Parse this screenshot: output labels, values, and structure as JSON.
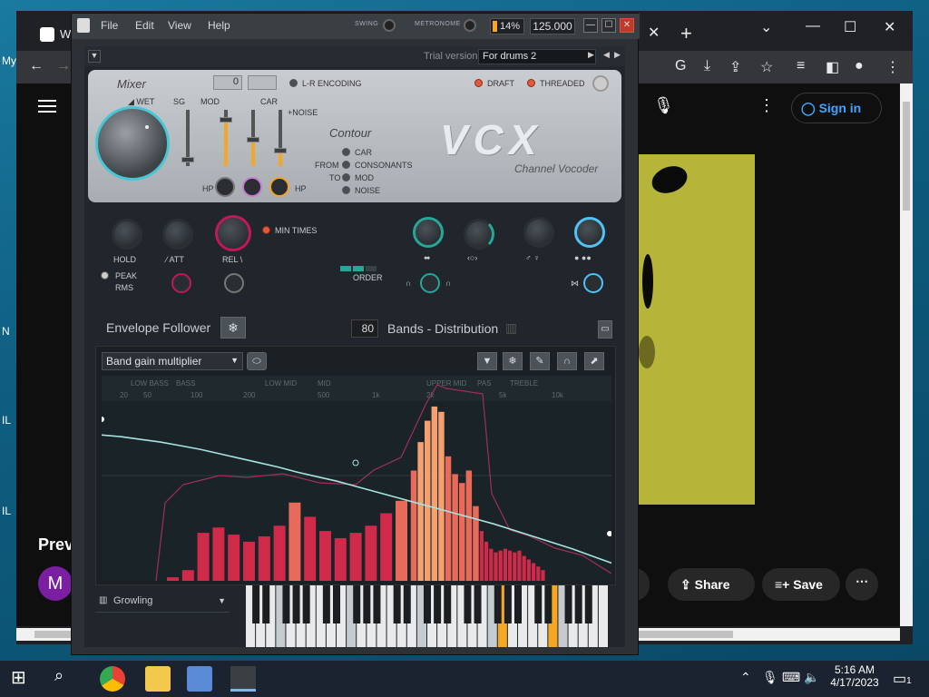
{
  "desktop": {
    "labels": [
      "My",
      "N",
      "IL",
      "IL"
    ]
  },
  "chrome": {
    "tab_title": "WE",
    "new_tab": "+",
    "tab_close": "✕",
    "signin": "Sign in",
    "preview_title": "Prev",
    "avatar_letter": "M",
    "share": "Share",
    "save": "Save"
  },
  "fl": {
    "menu": [
      "File",
      "Edit",
      "View",
      "Help"
    ],
    "swing_label": "SWING",
    "metronome_label": "METRONOME",
    "cpu": "14%",
    "tempo": "125.000",
    "trial": "Trial version",
    "preset": "For drums 2",
    "vcx": {
      "mixer": "Mixer",
      "wet": "WET",
      "sg": "SG",
      "mod": "MOD",
      "car": "CAR",
      "noise": "+NOISE",
      "hp1": "HP",
      "hp2": "HP",
      "num1": "0",
      "num2": "",
      "lr_encoding": "L-R ENCODING",
      "draft": "DRAFT",
      "threaded": "THREADED",
      "contour": "Contour",
      "from": "FROM",
      "to": "TO",
      "contour_options": [
        "CAR",
        "CONSONANTS",
        "MOD",
        "NOISE"
      ],
      "logo": "VCX",
      "subtitle": "Channel Vocoder"
    },
    "envelope": {
      "hold": "HOLD",
      "att": "ATT",
      "rel": "REL",
      "min_times": "MIN TIMES",
      "peak": "PEAK",
      "rms": "RMS",
      "order": "ORDER",
      "title": "Envelope Follower"
    },
    "bands": {
      "count": "80",
      "label": "Bands - Distribution"
    },
    "graph": {
      "mode": "Band gain multiplier",
      "region_labels": [
        "LOW BASS",
        "BASS",
        "LOW MID",
        "MID",
        "UPPER MID",
        "PAS",
        "TREBLE"
      ],
      "freq_labels": [
        "20",
        "50",
        "100",
        "200",
        "500",
        "1k",
        "2k",
        "5k",
        "10k"
      ]
    },
    "keyboard_preset": "Growling"
  },
  "taskbar": {
    "time": "5:16 AM",
    "date": "4/17/2023",
    "notifications": "1"
  },
  "chart_data": {
    "type": "bar",
    "title": "",
    "values": [
      2,
      6,
      27,
      30,
      26,
      22,
      25,
      31,
      44,
      36,
      28,
      24,
      27,
      31,
      38,
      45,
      62,
      78,
      90,
      98,
      95,
      70,
      60,
      55,
      62,
      42,
      28,
      22,
      18,
      16,
      17,
      18,
      17,
      16,
      17,
      14,
      12,
      10,
      8,
      6
    ],
    "curve": [
      82,
      81,
      79.5,
      78,
      76,
      74,
      71.5,
      69,
      66.5,
      64,
      61,
      58.5,
      56,
      53,
      50,
      47,
      44,
      41,
      38,
      35,
      32,
      28.5,
      25,
      21.5,
      18,
      14,
      10
    ],
    "ylim": [
      0,
      100
    ]
  }
}
